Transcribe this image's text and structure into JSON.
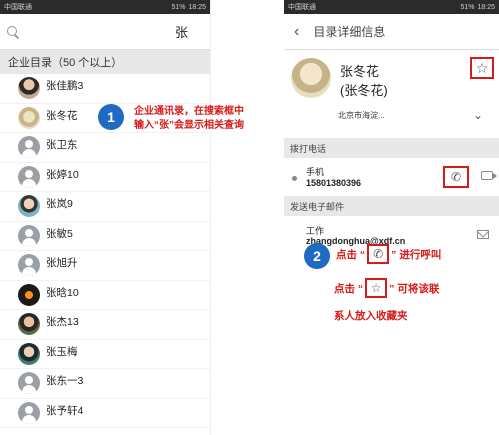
{
  "status_bar": {
    "carrier_left": "中国联通",
    "time_left": "18:25",
    "carrier_right": "中国联通",
    "time_right": "18:25",
    "battery": "51%"
  },
  "search": {
    "query": "张"
  },
  "directory": {
    "section_title": "企业目录（50 个以上）",
    "contacts": [
      {
        "name": "张佳鹏3",
        "avatar": "photo1"
      },
      {
        "name": "张冬花",
        "avatar": "photo2"
      },
      {
        "name": "张卫东",
        "avatar": "default"
      },
      {
        "name": "张婷10",
        "avatar": "default"
      },
      {
        "name": "张岚9",
        "avatar": "photo3"
      },
      {
        "name": "张敏5",
        "avatar": "default"
      },
      {
        "name": "张旭升",
        "avatar": "default"
      },
      {
        "name": "张晗10",
        "avatar": "photo4"
      },
      {
        "name": "张杰13",
        "avatar": "photo5"
      },
      {
        "name": "张玉梅",
        "avatar": "photo6"
      },
      {
        "name": "张东一3",
        "avatar": "default"
      },
      {
        "name": "张予轩4",
        "avatar": "default"
      }
    ]
  },
  "callout1": {
    "step": "1",
    "text": "企业通讯录，在搜索框中输入“张”会显示相关查询"
  },
  "detail": {
    "nav_title": "目录详细信息",
    "name": "张冬花",
    "alias": "(张冬花)",
    "address": "北京市海淀...",
    "dial_header": "拨打电话",
    "phone_label": "手机",
    "phone_number": "15801380396",
    "email_header": "发送电子邮件",
    "email_label": "工作",
    "email_address": "zhangdonghua@xdf.cn"
  },
  "callout2": {
    "step": "2",
    "line1_pre": "点击 “",
    "line1_post": "” 进行呼叫",
    "line2_pre": "点击 “",
    "line2_post": "” 可将该联",
    "line3": "系人放入收藏夹"
  },
  "icons": {
    "star": "☆",
    "phone": "✆",
    "back": "←",
    "clear": "✕",
    "chevron_left": "‹",
    "chevron_down": "⌄"
  },
  "colors": {
    "accent_red": "#d61a1a",
    "step_blue": "#1e6bc1"
  }
}
